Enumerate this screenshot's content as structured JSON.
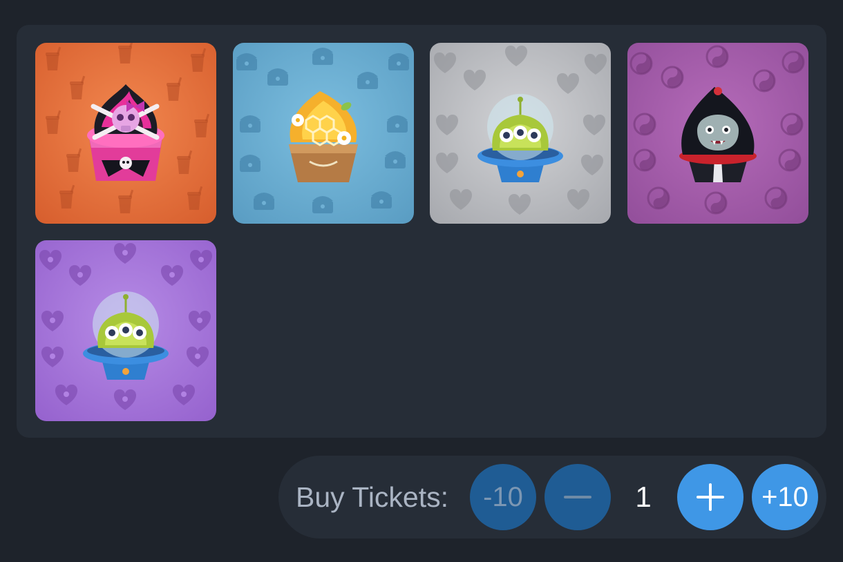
{
  "rewards": [
    {
      "name": "skull-cupcake",
      "bg": "#e36b3c",
      "pattern": "drink-cup"
    },
    {
      "name": "honeycomb-cupcake",
      "bg": "#66a8cf",
      "pattern": "treasure-chest"
    },
    {
      "name": "alien-dome-cupcake",
      "bg": "#bcbec3",
      "pattern": "heart-bandage"
    },
    {
      "name": "vampire-cupcake",
      "bg": "#a35aa8",
      "pattern": "yin-yang"
    },
    {
      "name": "alien-dome-cupcake",
      "bg": "#a16fd4",
      "pattern": "heart-donut"
    }
  ],
  "tickets": {
    "label": "Buy Tickets:",
    "minus_ten": "-10",
    "minus_icon": "minus-icon",
    "quantity": "1",
    "plus_icon": "plus-icon",
    "plus_ten": "+10"
  },
  "colors": {
    "page_bg": "#1e232b",
    "panel_bg": "#262d37",
    "button_active": "#3f97e6",
    "button_disabled": "#1f5c94"
  }
}
